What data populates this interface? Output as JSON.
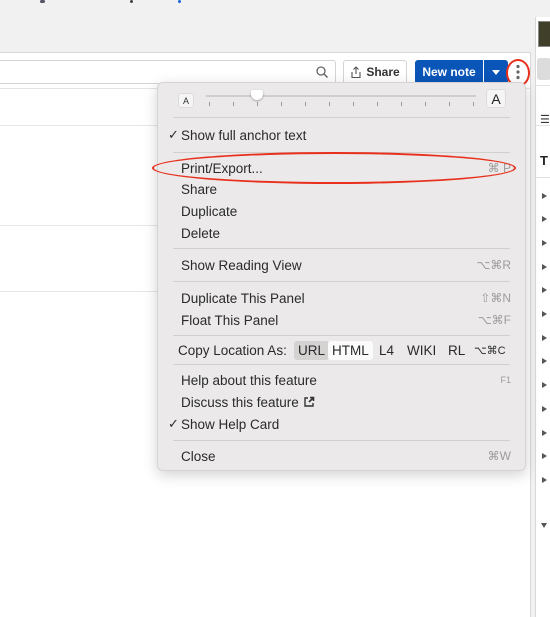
{
  "top_bar": {
    "cut_text_marks": [
      "partial-glyph",
      "partial-glyph",
      "partial-link-glyph"
    ]
  },
  "toolbar": {
    "search_placeholder": "",
    "share_label": "Share",
    "new_note_label": "New note"
  },
  "menu": {
    "font_size_slider": {
      "small_label": "A",
      "large_label": "A",
      "tick_count": 12,
      "value_fraction": 0.18
    },
    "items": [
      {
        "label": "Show full anchor text",
        "checked": true,
        "shortcut": ""
      },
      {
        "label": "Print/Export...",
        "checked": false,
        "shortcut": "⌘ P"
      },
      {
        "label": "Share",
        "checked": false,
        "shortcut": ""
      },
      {
        "label": "Duplicate",
        "checked": false,
        "shortcut": ""
      },
      {
        "label": "Delete",
        "checked": false,
        "shortcut": ""
      },
      {
        "label": "Show Reading View",
        "checked": false,
        "shortcut": "⌥⌘R"
      },
      {
        "label": "Duplicate This Panel",
        "checked": false,
        "shortcut": "⇧⌘N"
      },
      {
        "label": "Float This Panel",
        "checked": false,
        "shortcut": "⌥⌘F"
      },
      {
        "label": "Help about this feature",
        "checked": false,
        "shortcut": "F1"
      },
      {
        "label": "Discuss this feature",
        "checked": false,
        "shortcut": ""
      },
      {
        "label": "Show Help Card",
        "checked": true,
        "shortcut": ""
      },
      {
        "label": "Close",
        "checked": false,
        "shortcut": "⌘W"
      }
    ],
    "copy_location": {
      "label": "Copy Location As:",
      "options": [
        "URL",
        "HTML",
        "L4",
        "WIKI",
        "RL"
      ],
      "selected": "URL",
      "shortcut": "⌥⌘C"
    },
    "check_glyph": "✓"
  },
  "annotations": {
    "highlight_color": "#e8301d"
  },
  "colors": {
    "primary_button": "#0a55b8",
    "menu_bg": "#ebe9e9"
  }
}
